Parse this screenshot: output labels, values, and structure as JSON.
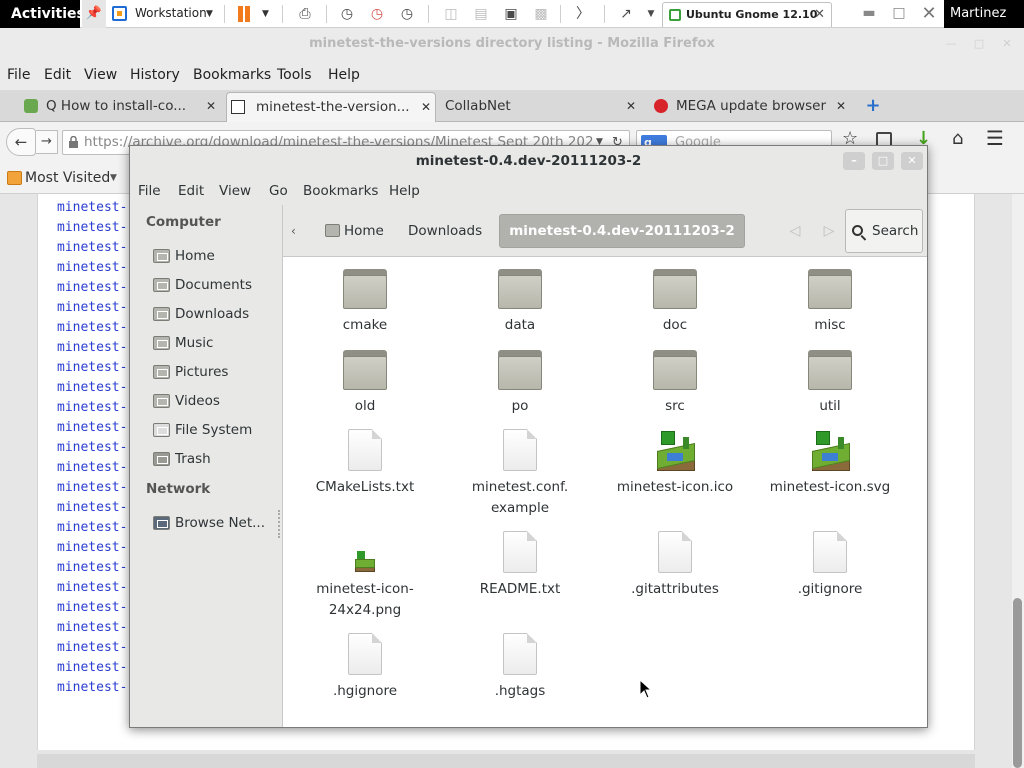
{
  "host": {
    "activities": "Activities",
    "workspace_label": "Workstation",
    "vm_tab_label": "Ubuntu Gnome 12.10",
    "user": "Martinez"
  },
  "firefox": {
    "title": "minetest-the-versions directory listing - Mozilla Firefox",
    "menu": [
      "File",
      "Edit",
      "View",
      "History",
      "Bookmarks",
      "Tools",
      "Help"
    ],
    "tabs": [
      {
        "label": "Q How to install-co...",
        "active": false
      },
      {
        "label": "minetest-the-version...",
        "active": true
      },
      {
        "label": "CollabNet",
        "active": false
      },
      {
        "label": "MEGA update browser",
        "active": false
      }
    ],
    "url": "https://archive.org/download/minetest-the-versions/Minetest Sept 20th 202",
    "search_placeholder": "Google",
    "search_engine": "g",
    "bookmarks": {
      "most_visited": "Most Visited"
    }
  },
  "page": {
    "dir_entries": [
      "minetest-",
      "minetest-",
      "minetest-",
      "minetest-",
      "minetest-",
      "minetest-",
      "minetest-",
      "minetest-",
      "minetest-",
      "minetest-",
      "minetest-",
      "minetest-",
      "minetest-",
      "minetest-",
      "minetest-",
      "minetest-",
      "minetest-",
      "minetest-",
      "minetest-",
      "minetest-",
      "minetest-",
      "minetest-",
      "minetest-",
      "minetest-",
      "minetest-"
    ]
  },
  "nautilus": {
    "title": "minetest-0.4.dev-20111203-2",
    "menu": [
      "File",
      "Edit",
      "View",
      "Go",
      "Bookmarks",
      "Help"
    ],
    "sidebar": {
      "computer_header": "Computer",
      "computer_items": [
        "Home",
        "Documents",
        "Downloads",
        "Music",
        "Pictures",
        "Videos",
        "File System",
        "Trash"
      ],
      "network_header": "Network",
      "network_items": [
        "Browse Net..."
      ]
    },
    "pathbar": {
      "home": "Home",
      "downloads": "Downloads",
      "current": "minetest-0.4.dev-20111203-2",
      "search": "Search"
    },
    "files": [
      {
        "name": "cmake",
        "kind": "folder"
      },
      {
        "name": "data",
        "kind": "folder"
      },
      {
        "name": "doc",
        "kind": "folder"
      },
      {
        "name": "misc",
        "kind": "folder"
      },
      {
        "name": "old",
        "kind": "folder"
      },
      {
        "name": "po",
        "kind": "folder"
      },
      {
        "name": "src",
        "kind": "folder"
      },
      {
        "name": "util",
        "kind": "folder"
      },
      {
        "name": "CMakeLists.txt",
        "kind": "document"
      },
      {
        "name": "minetest.conf.",
        "name2": "example",
        "kind": "document"
      },
      {
        "name": "minetest-icon.ico",
        "kind": "image-large"
      },
      {
        "name": "minetest-icon.svg",
        "kind": "image-large"
      },
      {
        "name": "minetest-icon-",
        "name2": "24x24.png",
        "kind": "image-small"
      },
      {
        "name": "README.txt",
        "kind": "document"
      },
      {
        "name": ".gitattributes",
        "kind": "document"
      },
      {
        "name": ".gitignore",
        "kind": "document"
      },
      {
        "name": ".hgignore",
        "kind": "document"
      },
      {
        "name": ".hgtags",
        "kind": "document"
      }
    ]
  }
}
